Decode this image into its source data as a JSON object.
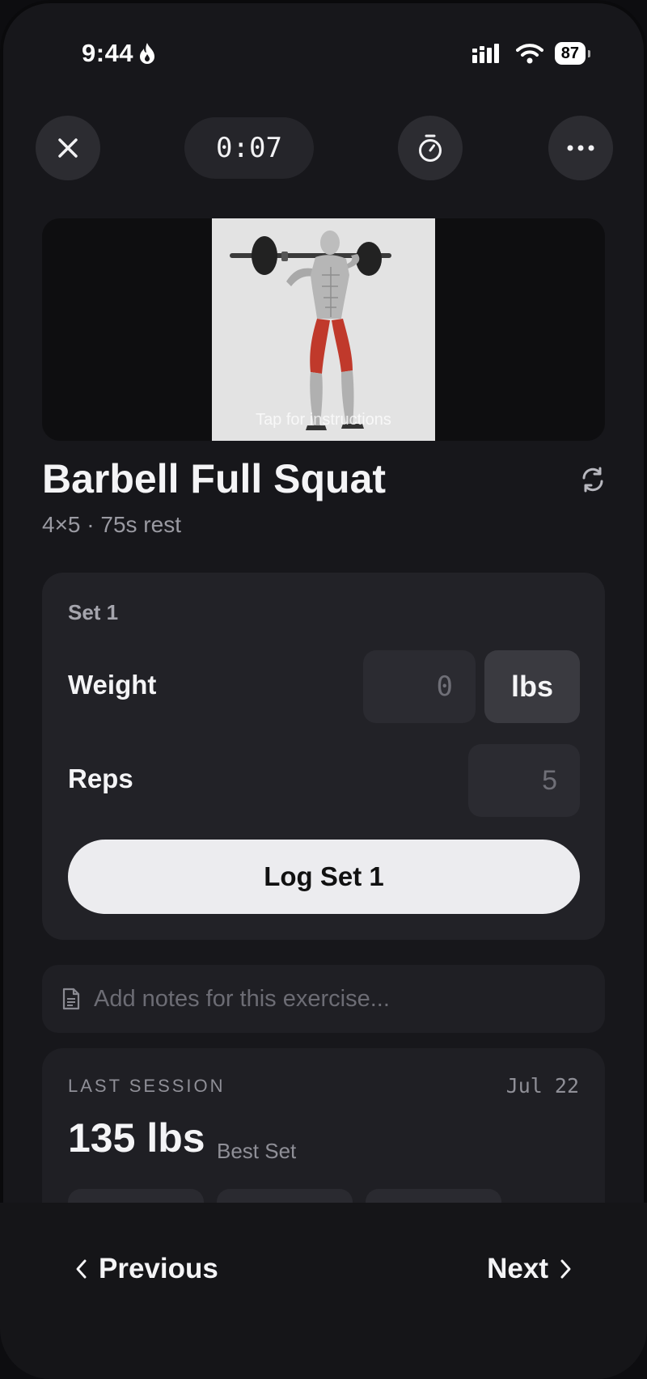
{
  "status": {
    "time": "9:44",
    "battery": "87"
  },
  "header": {
    "timer": "0:07"
  },
  "media": {
    "hint": "Tap for instructions"
  },
  "exercise": {
    "title": "Barbell Full Squat",
    "subtitle": "4×5 · 75s rest"
  },
  "set": {
    "label": "Set 1",
    "weight_label": "Weight",
    "weight_value": "0",
    "unit": "lbs",
    "reps_label": "Reps",
    "reps_value": "5",
    "log_label": "Log Set 1"
  },
  "notes": {
    "placeholder": "Add notes for this exercise..."
  },
  "last_session": {
    "label": "LAST SESSION",
    "date": "Jul 22",
    "best_value": "135 lbs",
    "best_label": "Best Set"
  },
  "nav": {
    "previous": "Previous",
    "next": "Next"
  }
}
